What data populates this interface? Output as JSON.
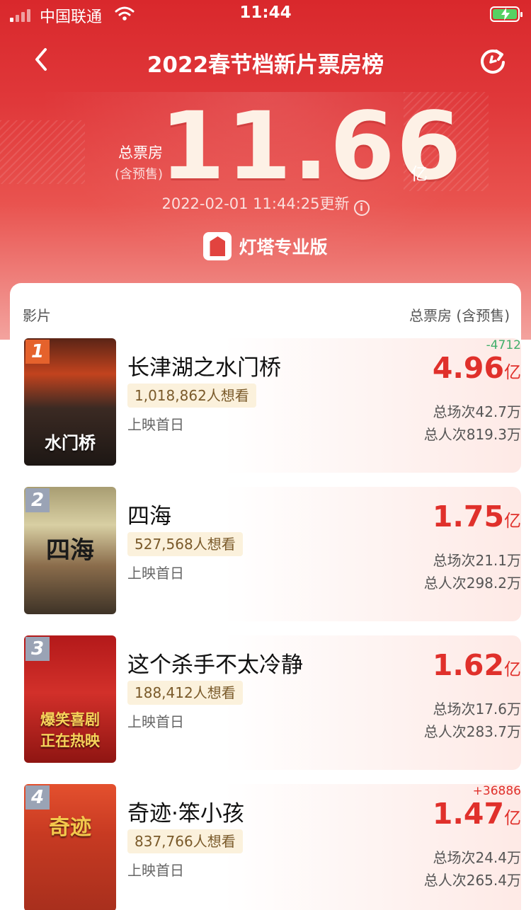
{
  "status_bar": {
    "carrier": "中国联通",
    "time": "11:44"
  },
  "nav": {
    "title": "2022春节档新片票房榜",
    "back_icon": "chevron-left-icon",
    "refresh_icon": "refresh-icon"
  },
  "summary": {
    "total_label": "总票房",
    "total_sub": "(含预售)",
    "total_value": "11.66",
    "total_unit": "亿",
    "updated": "2022-02-01 11:44:25更新",
    "info_icon": "i",
    "brand": "灯塔专业版"
  },
  "list": {
    "header_left": "影片",
    "header_right": "总票房 (含预售)",
    "colors": {
      "rank1": "#e5622c",
      "rank_other": "#9aa3b5",
      "box": "#e0302b",
      "delta_down": "#3fae6a",
      "delta_up": "#e0302b"
    },
    "movies": [
      {
        "rank": "1",
        "title": "长津湖之水门桥",
        "wants": "1,018,862人想看",
        "release": "上映首日",
        "delta": "-4712",
        "delta_dir": "down",
        "box": "4.96",
        "unit": "亿",
        "shows": "总场次42.7万",
        "viewers": "总人次819.3万",
        "poster_text": "水门桥"
      },
      {
        "rank": "2",
        "title": "四海",
        "wants": "527,568人想看",
        "release": "上映首日",
        "delta": "",
        "delta_dir": "",
        "box": "1.75",
        "unit": "亿",
        "shows": "总场次21.1万",
        "viewers": "总人次298.2万",
        "poster_text": "四海"
      },
      {
        "rank": "3",
        "title": "这个杀手不太冷静",
        "wants": "188,412人想看",
        "release": "上映首日",
        "delta": "",
        "delta_dir": "",
        "box": "1.62",
        "unit": "亿",
        "shows": "总场次17.6万",
        "viewers": "总人次283.7万",
        "poster_text": "爆笑喜剧 正在热映"
      },
      {
        "rank": "4",
        "title": "奇迹·笨小孩",
        "wants": "837,766人想看",
        "release": "上映首日",
        "delta": "+36886",
        "delta_dir": "up",
        "box": "1.47",
        "unit": "亿",
        "shows": "总场次24.4万",
        "viewers": "总人次265.4万",
        "poster_text": "奇迹"
      }
    ]
  }
}
